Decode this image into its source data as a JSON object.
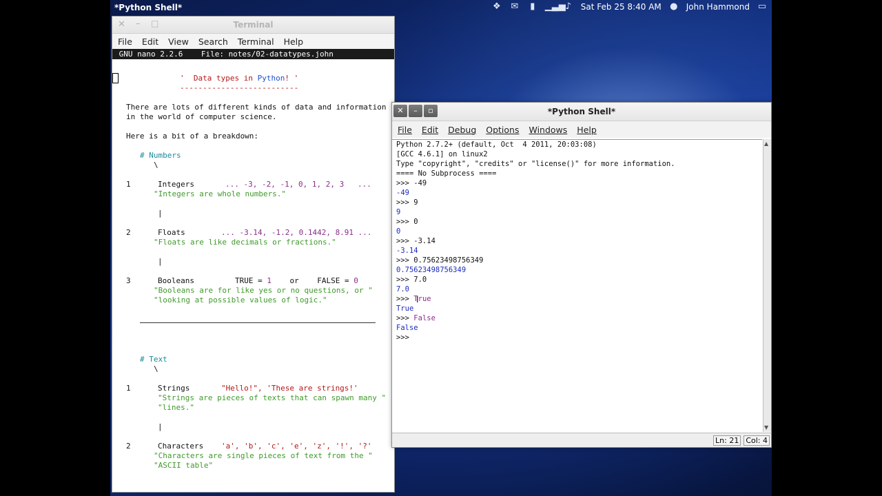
{
  "topbar": {
    "app_name": "*Python Shell*",
    "datetime": "Sat Feb 25  8:40 AM",
    "user": "John Hammond",
    "icons": [
      "dropbox-icon",
      "mail-icon",
      "battery-icon",
      "signal-icon",
      "volume-icon",
      "user-icon",
      "display-icon"
    ]
  },
  "terminal": {
    "title": "Terminal",
    "menu": [
      "File",
      "Edit",
      "View",
      "Search",
      "Terminal",
      "Help"
    ],
    "nano_header": " GNU nano 2.2.6    File: notes/02-datatypes.john",
    "content": {
      "title_left": "'  Data types in ",
      "title_python": "Python",
      "title_right": "! '",
      "underline": "--------------------------",
      "intro1": "There are lots of different kinds of data and information",
      "intro2": "in the world of computer science.",
      "intro3": "Here is a bit of a breakdown:",
      "numbers_hdr": "# Numbers",
      "backslash": "\\",
      "pipe": "|",
      "n1": "1",
      "n2": "2",
      "n3": "3",
      "integers": "Integers",
      "integers_vals": "... -3, -2, -1, 0, 1, 2, 3   ...",
      "integers_desc": "\"Integers are whole numbers.\"",
      "floats": "Floats",
      "floats_vals": "... -3.14, -1.2, 0.1442, 8.91 ...",
      "floats_desc": "\"Floats are like decimals or fractions.\"",
      "booleans": "Booleans",
      "true_eq": "TRUE = ",
      "one": "1",
      "or": "or",
      "false_eq": "FALSE = ",
      "zero": "0",
      "bool_desc1": "\"Booleans are for like yes or no questions, or \"",
      "bool_desc2": "\"looking at possible values of logic.\"",
      "text_hdr": "# Text",
      "strings": "Strings",
      "strings_vals": "\"Hello!\", 'These are strings!'",
      "strings_desc1": "\"Strings are pieces of texts that can spawn many \"",
      "strings_desc2": "\"lines.\"",
      "characters": "Characters",
      "chars_vals": "'a', 'b', 'c', 'e', 'z', '!', '?'",
      "chars_desc1": "\"Characters are single pieces of text from the \"",
      "chars_desc2": "\"ASCII table\""
    }
  },
  "shell": {
    "title": "*Python Shell*",
    "menu": [
      "File",
      "Edit",
      "Debug",
      "Options",
      "Windows",
      "Help"
    ],
    "lines": [
      {
        "t": "Python 2.7.2+ (default, Oct  4 2011, 20:03:08)",
        "k": "text"
      },
      {
        "t": "[GCC 4.6.1] on linux2",
        "k": "text"
      },
      {
        "t": "Type \"copyright\", \"credits\" or \"license()\" for more information.",
        "k": "text"
      },
      {
        "t": "==== No Subprocess ====",
        "k": "text"
      },
      {
        "t": ">>> -49",
        "k": "in"
      },
      {
        "t": "-49",
        "k": "out"
      },
      {
        "t": ">>> 9",
        "k": "in"
      },
      {
        "t": "9",
        "k": "out"
      },
      {
        "t": ">>> 0",
        "k": "in"
      },
      {
        "t": "0",
        "k": "out"
      },
      {
        "t": ">>> -3.14",
        "k": "in"
      },
      {
        "t": "-3.14",
        "k": "out"
      },
      {
        "t": ">>> 0.75623498756349",
        "k": "in"
      },
      {
        "t": "0.75623498756349",
        "k": "out"
      },
      {
        "t": ">>> 7.0",
        "k": "in"
      },
      {
        "t": "7.0",
        "k": "out"
      },
      {
        "t": ">>> True",
        "k": "kw"
      },
      {
        "t": "True",
        "k": "out"
      },
      {
        "t": ">>> False",
        "k": "kw"
      },
      {
        "t": "False",
        "k": "out"
      },
      {
        "t": ">>>",
        "k": "in"
      }
    ],
    "status_ln": "Ln: 21",
    "status_col": "Col: 4"
  }
}
